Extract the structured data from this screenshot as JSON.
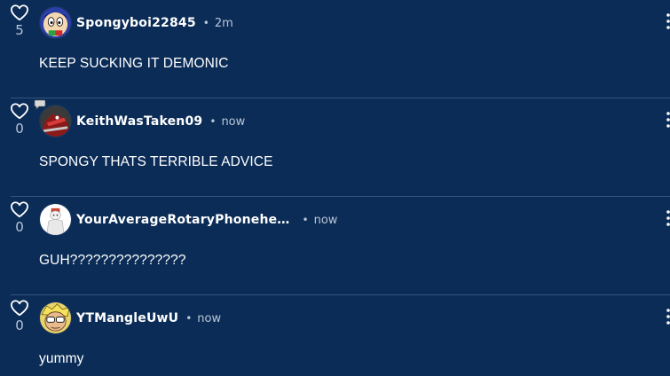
{
  "comments": [
    {
      "username": "Spongyboi22845",
      "time": "2m",
      "text": "KEEP SUCKING IT DEMONIC",
      "likes": "5",
      "avatar_icon": "cartoon-face-avatar"
    },
    {
      "username": "KeithWasTaken09",
      "time": "now",
      "text": "SPONGY THATS TERRIBLE ADVICE",
      "likes": "0",
      "avatar_icon": "red-dark-character-avatar"
    },
    {
      "username": "YourAverageRotaryPhonehe…",
      "time": "now",
      "text": "GUH???????????????",
      "likes": "0",
      "avatar_icon": "white-figure-avatar"
    },
    {
      "username": "YTMangleUwU",
      "time": "now",
      "text": "yummy",
      "likes": "0",
      "avatar_icon": "yellow-hair-character-avatar"
    }
  ],
  "separator": "•",
  "colors": {
    "background": "#0b2c57",
    "divider": "#2e5680",
    "muted_text": "#b9c6d6"
  }
}
